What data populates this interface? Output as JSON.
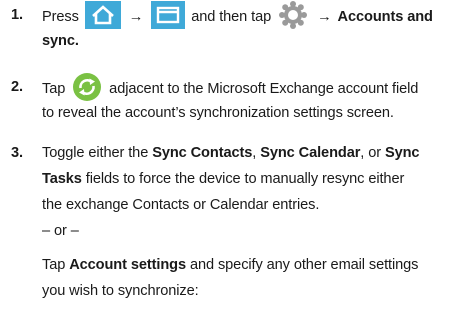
{
  "steps": [
    {
      "number": "1.",
      "lines": [
        {
          "press": "Press",
          "arrow1": "→",
          "mid": "and then tap",
          "arrow2": "→",
          "bold_end": "Accounts and"
        },
        {
          "bold": "sync."
        }
      ]
    },
    {
      "number": "2.",
      "lines": [
        {
          "pre": "Tap",
          "post": "adjacent to the Microsoft Exchange account field"
        },
        {
          "text": "to reveal the account’s synchronization settings screen."
        }
      ]
    },
    {
      "number": "3.",
      "lines": [
        {
          "t1": "Toggle either the",
          "b1": "Sync Contacts",
          "t2": ",",
          "b2": "Sync Calendar",
          "t3": ", or",
          "b3": "Sync"
        },
        {
          "b1": "Tasks",
          "t1": "fields to force the device to manually resync either"
        },
        {
          "text": "the exchange Contacts or Calendar entries."
        },
        {
          "text": "– or –"
        },
        {
          "t1": "Tap",
          "b1": "Account settings",
          "t2": "and specify any other email settings"
        },
        {
          "text": "you wish to synchronize:"
        }
      ]
    }
  ],
  "icons": {
    "home": "home-icon",
    "menu": "menu-icon",
    "settings": "gear-icon",
    "sync": "sync-icon"
  },
  "colors": {
    "icon_blue": "#3fa9d8",
    "gear_gray": "#9a9a9a",
    "sync_green": "#7ac143"
  }
}
